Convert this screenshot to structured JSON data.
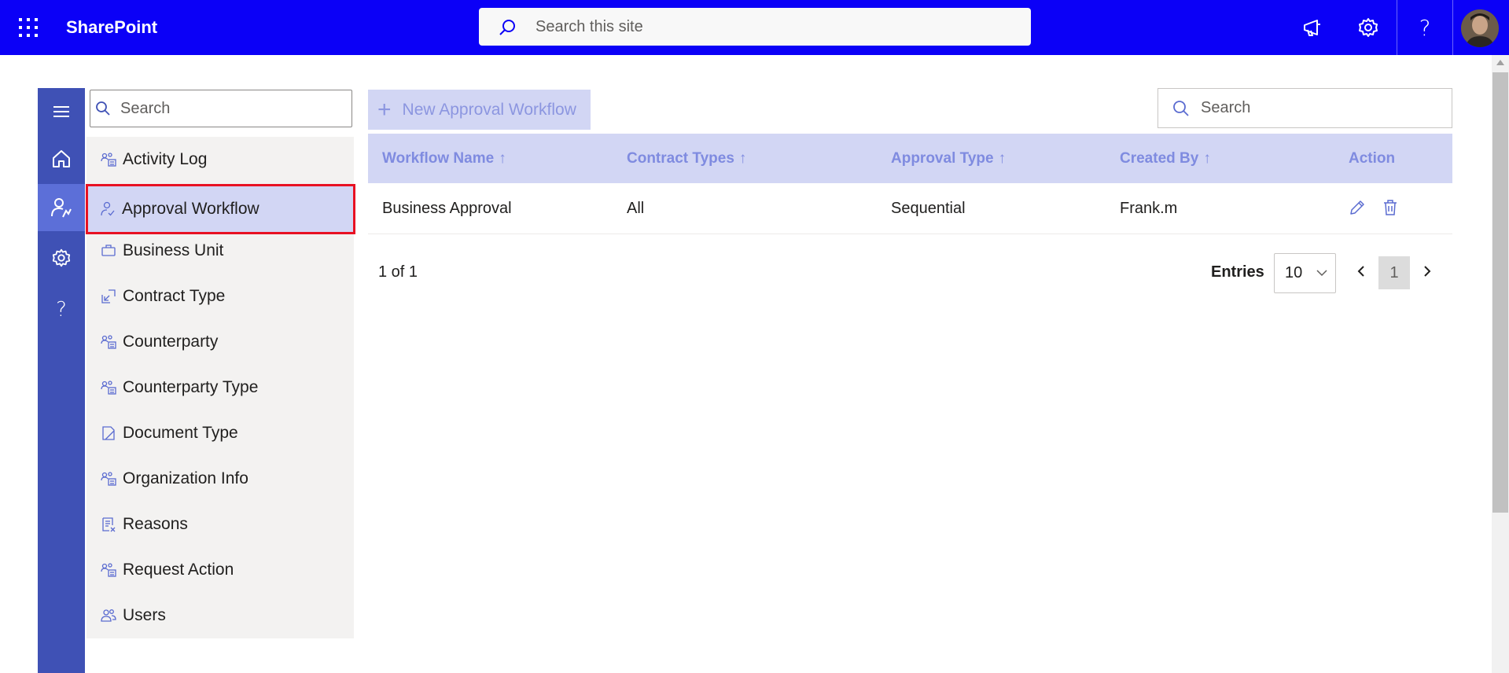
{
  "app": {
    "brand": "SharePoint"
  },
  "topbar": {
    "search_placeholder": "Search this site",
    "icons": [
      "app-launcher-icon",
      "megaphone-icon",
      "gear-icon",
      "help-icon"
    ],
    "help_label": "?"
  },
  "rail": {
    "items": [
      "menu-icon",
      "home-icon",
      "admin-users-icon",
      "gear-icon",
      "help-icon"
    ],
    "active_index": 2,
    "help_label": "?"
  },
  "nav": {
    "search_placeholder": "Search",
    "items": [
      {
        "label": "Activity Log",
        "icon": "people-group-icon"
      },
      {
        "label": "Approval Workflow",
        "icon": "person-check-icon",
        "selected": true
      },
      {
        "label": "Business Unit",
        "icon": "briefcase-icon"
      },
      {
        "label": "Contract Type",
        "icon": "contract-type-icon"
      },
      {
        "label": "Counterparty",
        "icon": "people-group-icon"
      },
      {
        "label": "Counterparty Type",
        "icon": "people-group-icon"
      },
      {
        "label": "Document Type",
        "icon": "document-icon"
      },
      {
        "label": "Organization Info",
        "icon": "people-group-icon"
      },
      {
        "label": "Reasons",
        "icon": "list-remove-icon"
      },
      {
        "label": "Request Action",
        "icon": "people-group-icon"
      },
      {
        "label": "Users",
        "icon": "people-icon"
      }
    ]
  },
  "toolbar": {
    "new_label": "New Approval Workflow",
    "search_placeholder": "Search"
  },
  "table": {
    "columns": [
      {
        "label": "Workflow Name",
        "sort": "↑"
      },
      {
        "label": "Contract Types",
        "sort": "↑"
      },
      {
        "label": "Approval Type",
        "sort": "↑"
      },
      {
        "label": "Created By",
        "sort": "↑"
      },
      {
        "label": "Action",
        "sort": ""
      }
    ],
    "rows": [
      {
        "workflow_name": "Business Approval",
        "contract_types": "All",
        "approval_type": "Sequential",
        "created_by": "Frank.m",
        "actions": [
          "edit-icon",
          "delete-icon"
        ]
      }
    ]
  },
  "pagination": {
    "info": "1 of 1",
    "entries_label": "Entries",
    "entries_value": "10",
    "current_page": "1"
  },
  "colors": {
    "topbar": "#0b00f7",
    "rail": "#3f51b5",
    "rail_active": "#5c6fd8",
    "header_bg": "#d2d6f4",
    "header_text": "#7f8be0",
    "selection_border": "#e81123"
  }
}
